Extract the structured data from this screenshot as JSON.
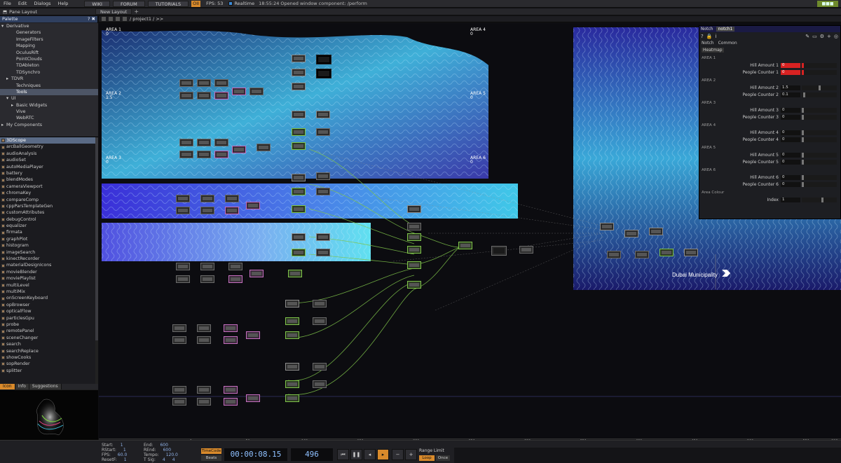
{
  "menubar": {
    "items": [
      "File",
      "Edit",
      "Dialogs",
      "Help"
    ],
    "wiki": "WIKI",
    "forum": "FORUM",
    "tutorials": "TUTORIALS",
    "oii": "OII",
    "fps_label": "FPS:",
    "fps_value": "53",
    "realtime": "Realtime",
    "status": "18:55:24 Opened window component: /perform"
  },
  "panebar": {
    "pane_layout": "Pane Layout",
    "new_layout": "New Layout"
  },
  "palette": {
    "title": "Palette",
    "tree": [
      {
        "label": "Derivative",
        "indent": 0,
        "arrow": "▾"
      },
      {
        "label": "Generators",
        "indent": 2,
        "arrow": ""
      },
      {
        "label": "ImageFilters",
        "indent": 2,
        "arrow": ""
      },
      {
        "label": "Mapping",
        "indent": 2,
        "arrow": ""
      },
      {
        "label": "OculusRift",
        "indent": 2,
        "arrow": ""
      },
      {
        "label": "PointClouds",
        "indent": 2,
        "arrow": ""
      },
      {
        "label": "TDAbleton",
        "indent": 2,
        "arrow": ""
      },
      {
        "label": "TDSynchro",
        "indent": 2,
        "arrow": ""
      },
      {
        "label": "TDVR",
        "indent": 1,
        "arrow": "▸"
      },
      {
        "label": "Techniques",
        "indent": 2,
        "arrow": ""
      },
      {
        "label": "Tools",
        "indent": 2,
        "arrow": "",
        "selected": true
      },
      {
        "label": "UI",
        "indent": 1,
        "arrow": "▾"
      },
      {
        "label": "Basic Widgets",
        "indent": 2,
        "arrow": "▸"
      },
      {
        "label": "Vive",
        "indent": 2,
        "arrow": ""
      },
      {
        "label": "WebRTC",
        "indent": 2,
        "arrow": ""
      },
      {
        "label": "My Components",
        "indent": 0,
        "arrow": "▸"
      }
    ],
    "components": [
      "3DScope",
      "arcBallGeometry",
      "audioAnalysis",
      "audioSet",
      "autoMediaPlayer",
      "battery",
      "blendModes",
      "cameraViewport",
      "chromaKey",
      "compareComp",
      "cppParsTemplateGen",
      "customAttributes",
      "debugControl",
      "equalizer",
      "firmata",
      "graphPlot",
      "histogram",
      "imageSearch",
      "kinectRecorder",
      "materialDesignIcons",
      "movieBlender",
      "moviePlaylist",
      "multiLevel",
      "multiMix",
      "onScreenKeyboard",
      "opBrowser",
      "opticalFlow",
      "particlesGpu",
      "probe",
      "remotePanel",
      "sceneChanger",
      "search",
      "searchReplace",
      "showCooks",
      "sopRender",
      "splitter"
    ],
    "info_tabs": [
      "Icon",
      "Info",
      "Suggestions"
    ]
  },
  "network_header": {
    "path": "/ project1 / >>"
  },
  "areas": [
    {
      "name": "AREA 1",
      "value": "0"
    },
    {
      "name": "AREA 4",
      "value": "0"
    },
    {
      "name": "AREA 2",
      "value": "1.5"
    },
    {
      "name": "AREA 5",
      "value": "0"
    },
    {
      "name": "AREA 3",
      "value": "0"
    },
    {
      "name": "AREA 6",
      "value": "0"
    }
  ],
  "params": {
    "op_type": "Notch",
    "op_name": "notch1",
    "tabs": [
      "Notch",
      "Common"
    ],
    "subtab": "Heatmap",
    "sections": [
      {
        "title": "AREA 1",
        "rows": [
          {
            "label": "Hill Amount 1",
            "value": "0",
            "red": true
          },
          {
            "label": "People Counter 1",
            "value": "0",
            "red": true
          }
        ]
      },
      {
        "title": "AREA 2",
        "rows": [
          {
            "label": "Hill Amount 2",
            "value": "1.5"
          },
          {
            "label": "People Counter 2",
            "value": "0.1"
          }
        ]
      },
      {
        "title": "AREA 3",
        "rows": [
          {
            "label": "Hill Amount 3",
            "value": "0"
          },
          {
            "label": "People Counter 3",
            "value": "0"
          }
        ]
      },
      {
        "title": "AREA 4",
        "rows": [
          {
            "label": "Hill Amount 4",
            "value": "0"
          },
          {
            "label": "People Counter 4",
            "value": "0"
          }
        ]
      },
      {
        "title": "AREA 5",
        "rows": [
          {
            "label": "Hill Amount 5",
            "value": "0"
          },
          {
            "label": "People Counter 5",
            "value": "0"
          }
        ]
      },
      {
        "title": "AREA 6",
        "rows": [
          {
            "label": "Hill Amount 6",
            "value": "0"
          },
          {
            "label": "People Counter 6",
            "value": "0"
          }
        ]
      },
      {
        "title": "Area Colour",
        "rows": [
          {
            "label": "Index",
            "value": "1"
          }
        ]
      }
    ]
  },
  "logo_text": "Dubai Municipality",
  "timeline": {
    "ticks": [
      "1",
      "51",
      "101",
      "151",
      "201",
      "251",
      "301",
      "351",
      "401",
      "451",
      "501",
      "551",
      "600"
    ]
  },
  "bottom": {
    "start_label": "Start:",
    "start": "1",
    "rstart_label": "RStart:",
    "rstart": "1",
    "fps_label": "FPS:",
    "fps": "60.0",
    "resetf_label": "ResetF:",
    "resetf": "1",
    "end_label": "End:",
    "end": "600",
    "rend_label": "REnd:",
    "rend": "600",
    "tempo_label": "Tempo:",
    "tempo": "120.0",
    "tsig_label": "T Sig:",
    "tsig_a": "4",
    "tsig_b": "4",
    "timecode_btn": "TimeCode",
    "beats_btn": "Beats",
    "timecode": "00:00:08.15",
    "frame": "496",
    "range_limit": "Range Limit",
    "loop": "Loop",
    "once": "Once"
  },
  "colors": {
    "accent": "#d98a2b",
    "palette_header": "#2f3f5f",
    "wire": "#7fc44a"
  }
}
